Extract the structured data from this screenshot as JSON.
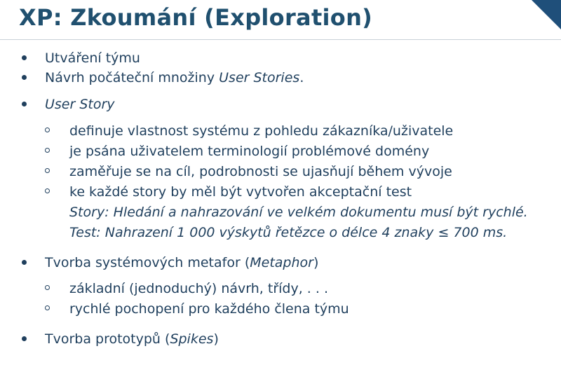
{
  "title": "XP: Zkoumání (Exploration)",
  "items": [
    {
      "text": "Utváření týmu"
    },
    {
      "text": "Návrh počáteční množiny ",
      "em": "User Stories",
      "after": "."
    },
    {
      "em": "User Story",
      "sub": [
        "definuje vlastnost systému z pohledu zákazníka/uživatele",
        "je psána uživatelem terminologií problémové domény",
        "zaměřuje se na cíl, podrobnosti se ujasňují během vývoje",
        "ke každé story by měl být vytvořen akceptační test"
      ],
      "story_example": "Story: Hledání a nahrazování ve velkém dokumentu musí být rychlé.",
      "test_example": "Test: Nahrazení 1 000 výskytů řetězce o délce 4 znaky ≤ 700 ms."
    },
    {
      "text": "Tvorba systémových metafor (",
      "em": "Metaphor",
      "after": ")",
      "sub": [
        "základní (jednoduchý) návrh, třídy, . . .",
        "rychlé pochopení pro každého člena týmu"
      ]
    },
    {
      "text": "Tvorba prototypů (",
      "em": "Spikes",
      "after": ")"
    }
  ]
}
